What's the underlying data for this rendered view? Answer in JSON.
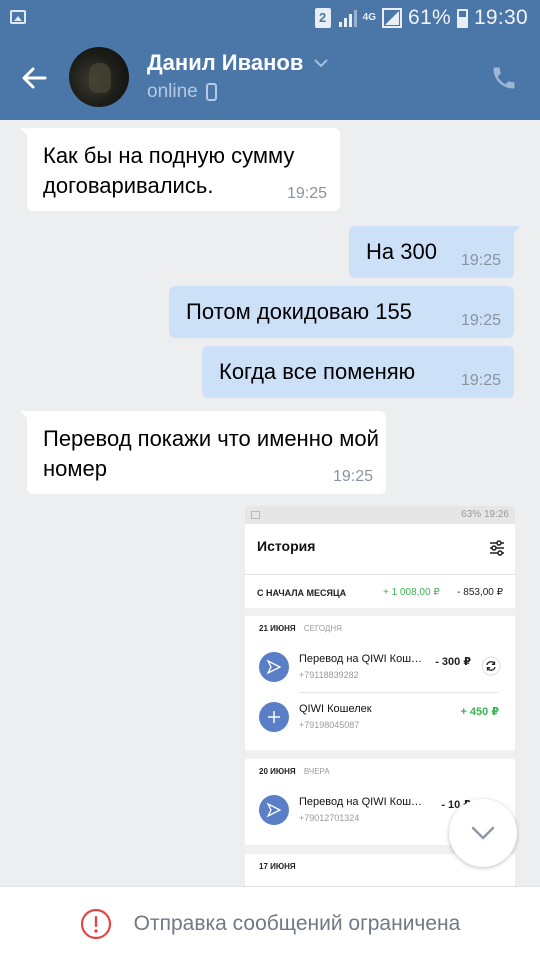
{
  "status_bar": {
    "sim": "2",
    "network": "4G",
    "battery": "61%",
    "time": "19:30"
  },
  "header": {
    "contact_name": "Данил Иванов",
    "status": "online",
    "back_icon": "arrow-left-icon",
    "call_icon": "phone-icon",
    "accent": "#4a76a8"
  },
  "messages": [
    {
      "direction": "in",
      "text": "Как бы на подную сумму договаривались.",
      "time": "19:25"
    },
    {
      "direction": "out",
      "text": "На 300",
      "time": "19:25"
    },
    {
      "direction": "out",
      "text": "Потом докидоваю 155",
      "time": "19:25"
    },
    {
      "direction": "out",
      "text": "Когда все поменяю",
      "time": "19:25"
    },
    {
      "direction": "in",
      "text": "Перевод покажи что именно мой номер",
      "time": "19:25"
    }
  ],
  "attachment": {
    "status_bar": "63% 19:26",
    "title": "История",
    "month_label": "С НАЧАЛА МЕСЯЦА",
    "month_income": "+ 1 008,00 ₽",
    "month_expense": "- 853,00 ₽",
    "days": [
      {
        "date": "21 ИЮНЯ",
        "relative": "СЕГОДНЯ",
        "rows": [
          {
            "title": "Перевод на QIWI Кошелек",
            "phone": "+79118839282",
            "amount": "- 300 ₽",
            "icon": "send-icon"
          },
          {
            "title": "QIWI Кошелек",
            "phone": "+79198045087",
            "amount": "+ 450 ₽",
            "icon": "plus-icon"
          }
        ]
      },
      {
        "date": "20 ИЮНЯ",
        "relative": "ВЧЕРА",
        "rows": [
          {
            "title": "Перевод на QIWI Кошелек",
            "phone": "+79012701324",
            "amount": "- 10 ₽",
            "icon": "send-icon"
          }
        ]
      },
      {
        "date": "17 ИЮНЯ",
        "relative": "",
        "rows": []
      }
    ]
  },
  "footer": {
    "notice": "Отправка сообщений ограничена"
  }
}
